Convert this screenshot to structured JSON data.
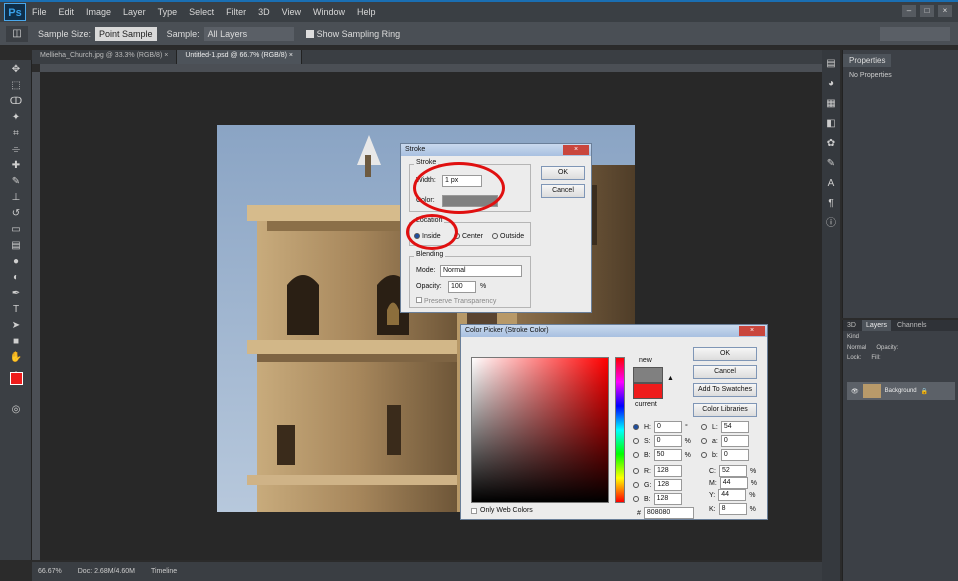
{
  "app": {
    "logo": "Ps",
    "menu": [
      "File",
      "Edit",
      "Image",
      "Layer",
      "Type",
      "Select",
      "Filter",
      "3D",
      "View",
      "Window",
      "Help"
    ],
    "window_controls": [
      "–",
      "□",
      "×"
    ]
  },
  "options_bar": {
    "tool_glyph": "◫",
    "sample_size_label": "Sample Size:",
    "sample_size_value": "Point Sample",
    "sample_label": "Sample:",
    "sample_value": "All Layers",
    "show_ring_label": "Show Sampling Ring"
  },
  "tabs": [
    {
      "label": "Mellieha_Church.jpg @ 33.3% (RGB/8) ×",
      "active": false
    },
    {
      "label": "Untitled-1.psd @ 66.7% (RGB/8) ×",
      "active": true
    }
  ],
  "status_bar": {
    "zoom": "66.67%",
    "doc_info": "Doc: 2.68M/4.60M",
    "bottom_label": "Timeline"
  },
  "properties_panel": {
    "tab": "Properties",
    "text": "No Properties"
  },
  "layers_panel": {
    "tabs": [
      "3D",
      "Layers",
      "Channels"
    ],
    "kind_label": "Kind",
    "blend_mode": "Normal",
    "opacity_label": "Opacity:",
    "lock_label": "Lock:",
    "fill_label": "Fill:",
    "layer_name": "Background"
  },
  "stroke_dialog": {
    "title": "Stroke",
    "close": "×",
    "stroke_group": "Stroke",
    "width_label": "Width:",
    "width_value": "1 px",
    "color_label": "Color:",
    "ok": "OK",
    "cancel": "Cancel",
    "location_group": "Location",
    "location_options": [
      "Inside",
      "Center",
      "Outside"
    ],
    "blending_group": "Blending",
    "mode_label": "Mode:",
    "mode_value": "Normal",
    "opacity_label": "Opacity:",
    "opacity_value": "100",
    "percent": "%",
    "preserve_label": "Preserve Transparency"
  },
  "picker_dialog": {
    "title": "Color Picker (Stroke Color)",
    "close": "×",
    "new_label": "new",
    "current_label": "current",
    "ok": "OK",
    "cancel": "Cancel",
    "add_swatches": "Add To Swatches",
    "color_libraries": "Color Libraries",
    "hsb": [
      {
        "label": "H:",
        "value": "0",
        "unit": "°"
      },
      {
        "label": "S:",
        "value": "0",
        "unit": "%"
      },
      {
        "label": "B:",
        "value": "50",
        "unit": "%"
      }
    ],
    "rgb": [
      {
        "label": "R:",
        "value": "128"
      },
      {
        "label": "G:",
        "value": "128"
      },
      {
        "label": "B:",
        "value": "128"
      }
    ],
    "lab": [
      {
        "label": "L:",
        "value": "54"
      },
      {
        "label": "a:",
        "value": "0"
      },
      {
        "label": "b:",
        "value": "0"
      }
    ],
    "cmyk": [
      {
        "label": "C:",
        "value": "52",
        "unit": "%"
      },
      {
        "label": "M:",
        "value": "44",
        "unit": "%"
      },
      {
        "label": "Y:",
        "value": "44",
        "unit": "%"
      },
      {
        "label": "K:",
        "value": "8",
        "unit": "%"
      }
    ],
    "hex_label": "#",
    "hex_value": "808080",
    "web_colors_label": "Only Web Colors"
  },
  "colors": {
    "foreground": "#ee1c1c",
    "new_color": "#808080",
    "current_color": "#ee1c1c",
    "annotation": "#e01010"
  }
}
